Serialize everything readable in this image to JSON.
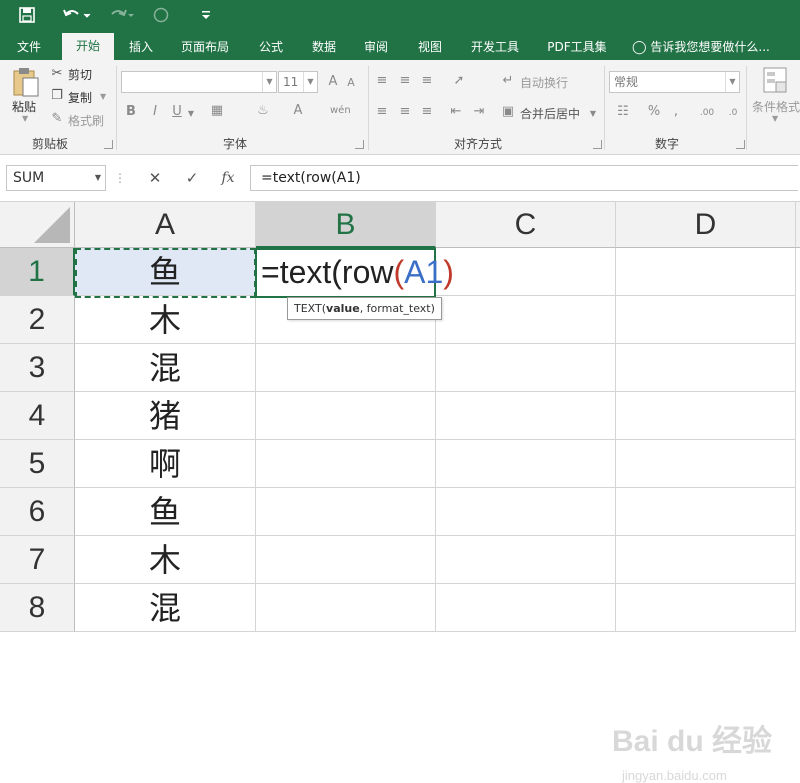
{
  "qat": {
    "save_icon": "save-icon",
    "undo_icon": "undo-icon",
    "redo_icon": "redo-icon",
    "customize_icon": "customize-icon"
  },
  "tabs": [
    {
      "label": "文件"
    },
    {
      "label": "开始",
      "active": true
    },
    {
      "label": "插入"
    },
    {
      "label": "页面布局"
    },
    {
      "label": "公式"
    },
    {
      "label": "数据"
    },
    {
      "label": "审阅"
    },
    {
      "label": "视图"
    },
    {
      "label": "开发工具"
    },
    {
      "label": "PDF工具集"
    }
  ],
  "tell_me": "告诉我您想要做什么...",
  "ribbon": {
    "clipboard": {
      "paste": "粘贴",
      "cut": "剪切",
      "copy": "复制",
      "format_painter": "格式刷",
      "label": "剪贴板"
    },
    "font": {
      "font_name": "",
      "font_size": "11",
      "label": "字体"
    },
    "alignment": {
      "wrap_text": "自动换行",
      "merge_center": "合并后居中",
      "label": "对齐方式"
    },
    "number": {
      "format": "常规",
      "label": "数字"
    },
    "styles": {
      "conditional_format": "条件格式"
    }
  },
  "formula_bar": {
    "name_box": "SUM",
    "formula": "=text(row(A1)"
  },
  "grid": {
    "columns": [
      "A",
      "B",
      "C",
      "D"
    ],
    "rows": [
      "1",
      "2",
      "3",
      "4",
      "5",
      "6",
      "7",
      "8"
    ],
    "col_a": [
      "鱼",
      "木",
      "混",
      "猪",
      "啊",
      "鱼",
      "木",
      "混"
    ]
  },
  "edit_cell": {
    "prefix": "=text(row",
    "open_paren": "(",
    "ref": "A1",
    "close_paren": ")"
  },
  "tooltip": {
    "fn": "TEXT(",
    "arg1": "value",
    "rest": ", format_text)"
  },
  "watermark": {
    "main": "Bai du 经验",
    "sub": "jingyan.baidu.com"
  }
}
